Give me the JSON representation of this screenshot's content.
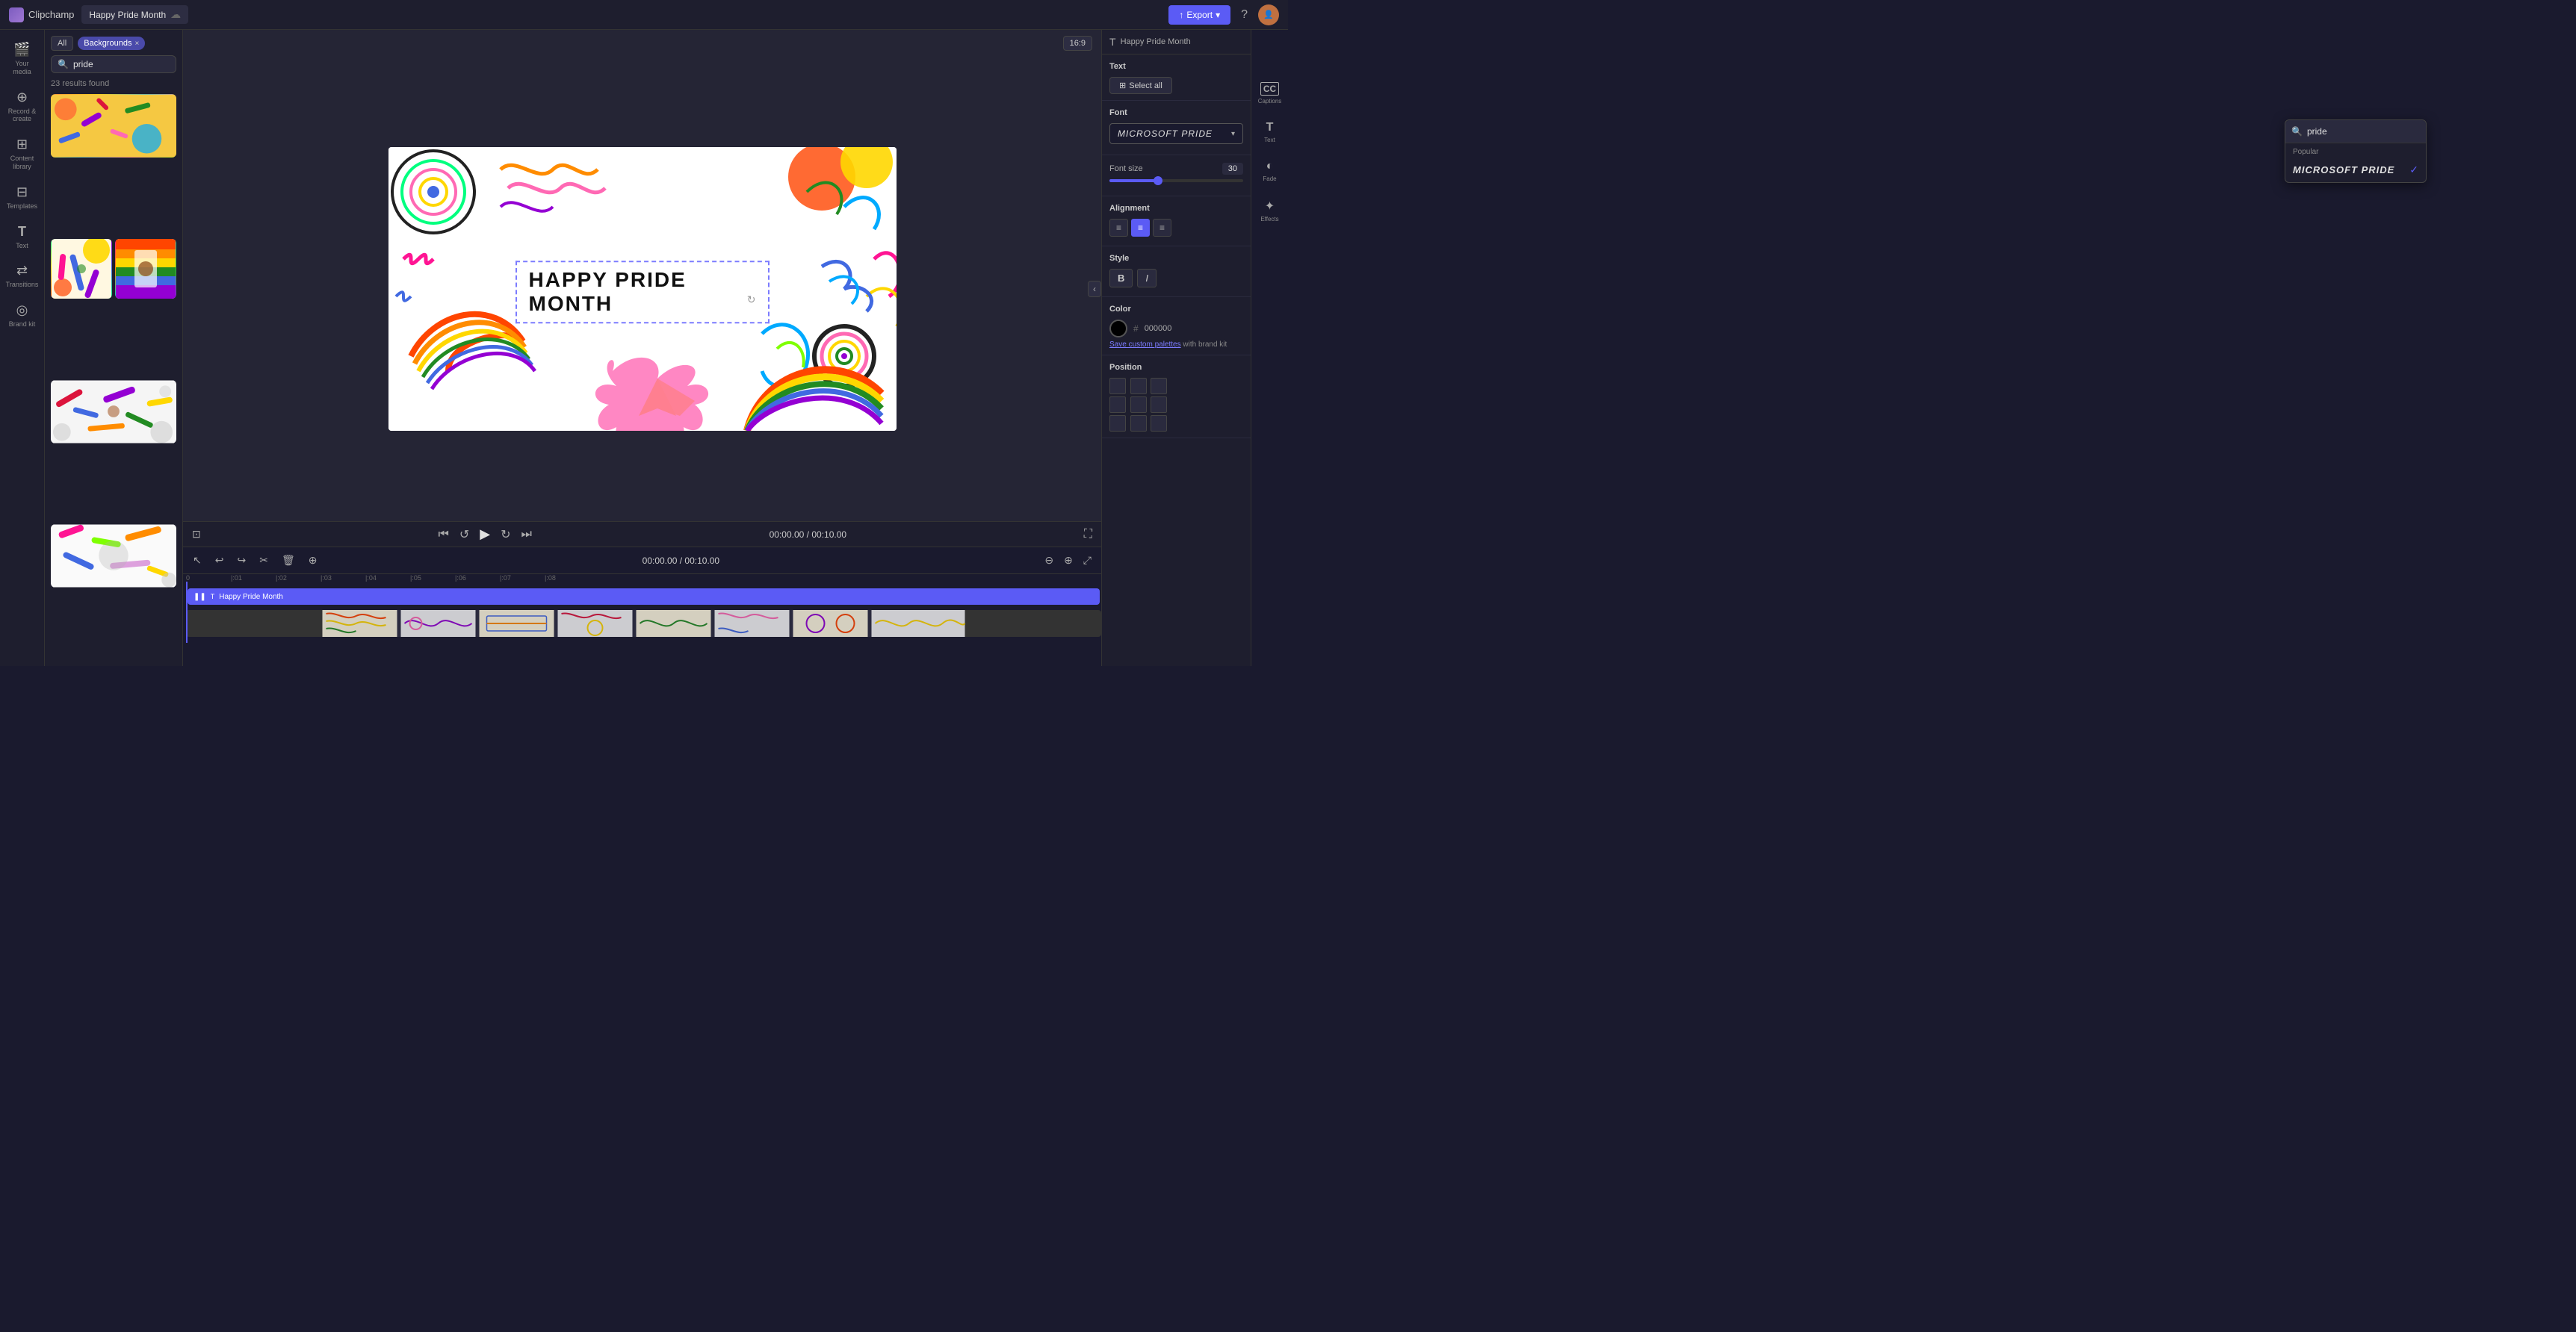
{
  "topbar": {
    "app_name": "Clipchamp",
    "tab_title": "Happy Pride Month",
    "export_label": "Export",
    "menu_icon": "☰",
    "captions_label": "CC",
    "help_icon": "?",
    "dropdown_arrow": "▾"
  },
  "sidebar": {
    "items": [
      {
        "id": "your-media",
        "icon": "🎬",
        "label": "Your media"
      },
      {
        "id": "record-create",
        "icon": "⊕",
        "label": "Record &\ncreate"
      },
      {
        "id": "content-library",
        "icon": "⊞",
        "label": "Content library"
      },
      {
        "id": "templates",
        "icon": "⊟",
        "label": "Templates"
      },
      {
        "id": "text",
        "icon": "T",
        "label": "Text"
      },
      {
        "id": "transitions",
        "icon": "⇄",
        "label": "Transitions"
      },
      {
        "id": "brand-kit",
        "icon": "◎",
        "label": "Brand kit"
      }
    ]
  },
  "left_panel": {
    "filter_all": "All",
    "filter_tag": "Backgrounds",
    "search_placeholder": "pride",
    "results_count": "23 results found",
    "close_icon": "×"
  },
  "canvas": {
    "aspect_ratio": "16:9",
    "title_text": "HAPPY PRIDE MONTH",
    "time_current": "00:00.00",
    "time_total": "00:10.00"
  },
  "right_panel": {
    "panel_title": "Happy Pride Month",
    "text_section_label": "Text",
    "select_all_label": "Select all",
    "font_section_label": "Font",
    "font_name": "MICROSOFT PRIDE",
    "font_size_label": "Font size",
    "font_size_value": "30",
    "font_search_placeholder": "pride",
    "font_dropdown_popular": "Popular",
    "font_dropdown_item": "MICROSOFT PRIDE",
    "alignment_label": "Alignment",
    "style_label": "Style",
    "bold_label": "B",
    "italic_label": "I",
    "color_label": "Color",
    "color_hex": "000000",
    "save_palettes_text": "Save custom palettes",
    "save_palettes_suffix": " with brand kit",
    "position_label": "Position"
  },
  "right_icons": [
    {
      "id": "captions",
      "icon": "CC",
      "label": "Captions"
    },
    {
      "id": "text-icon",
      "icon": "T",
      "label": "Text"
    },
    {
      "id": "fade",
      "icon": "◐",
      "label": "Fade"
    },
    {
      "id": "effects",
      "icon": "✦",
      "label": "Effects"
    }
  ],
  "timeline": {
    "time_display": "00:00.00 / 00:10.00",
    "track_label": "Happy Pride Month",
    "ruler_marks": [
      "0",
      "|:01",
      "|:02",
      "|:03",
      "|:04",
      "|:05",
      "|:06",
      "|:07",
      "|:08"
    ]
  }
}
